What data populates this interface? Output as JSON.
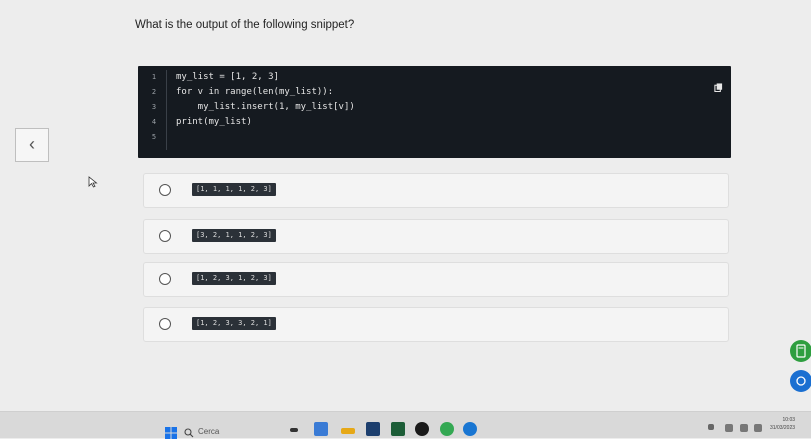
{
  "question": "What is the output of the following snippet?",
  "code": {
    "lines": [
      {
        "n": "1",
        "text": "my_list = [1, 2, 3]"
      },
      {
        "n": "2",
        "text": "for v in range(len(my_list)):"
      },
      {
        "n": "3",
        "text": "    my_list.insert(1, my_list[v])"
      },
      {
        "n": "4",
        "text": "print(my_list)"
      },
      {
        "n": "5",
        "text": ""
      }
    ]
  },
  "options": [
    {
      "label": "[1, 1, 1, 1, 2, 3]"
    },
    {
      "label": "[3, 2, 1, 1, 2, 3]"
    },
    {
      "label": "[1, 2, 3, 1, 2, 3]"
    },
    {
      "label": "[1, 2, 3, 3, 2, 1]"
    }
  ],
  "taskbar": {
    "search_placeholder": "Cerca",
    "time": "10:03",
    "date": "31/03/2023"
  },
  "colors": {
    "code_bg": "#151a20",
    "option_bg": "#f4f4f4",
    "accent_green": "#2e9e3f",
    "accent_blue": "#1a6fd1"
  }
}
